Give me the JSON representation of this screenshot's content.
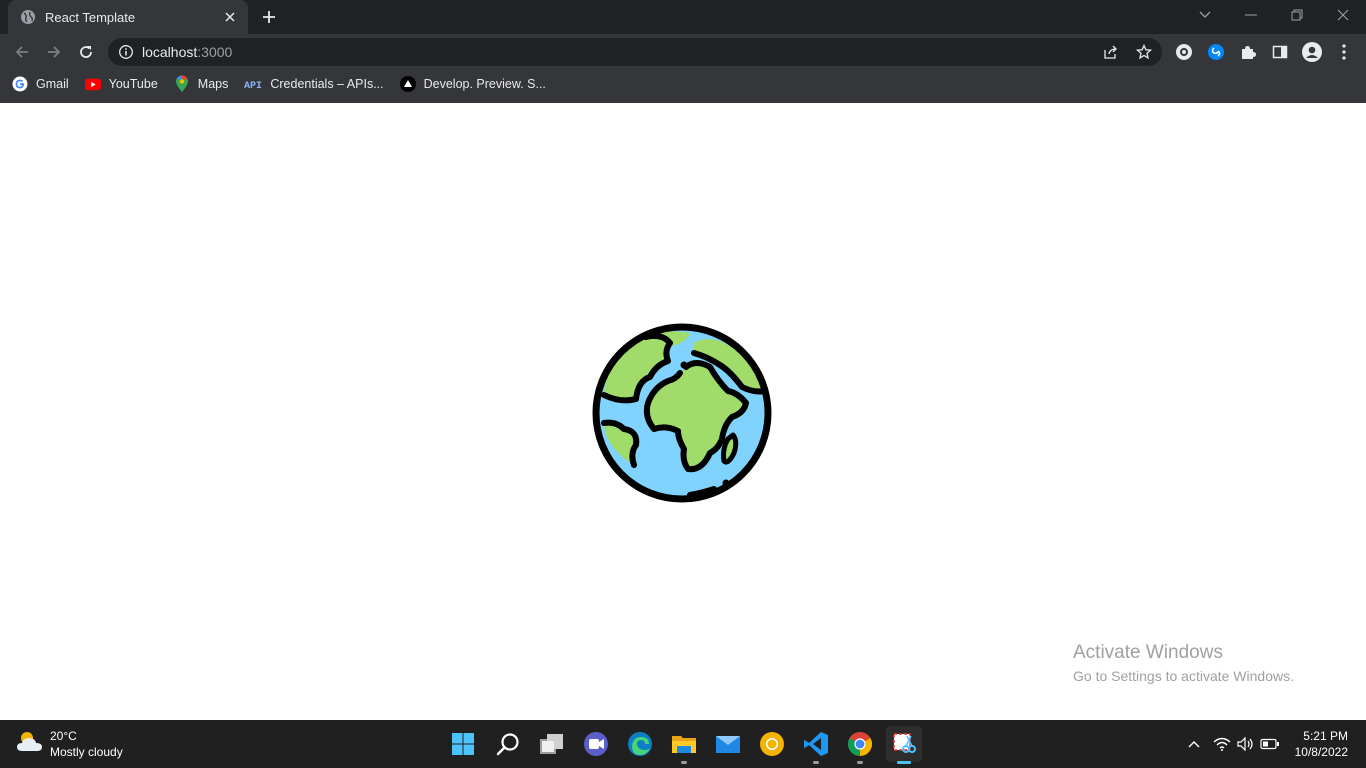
{
  "browser": {
    "tab": {
      "title": "React Template",
      "favicon": "globe-favicon"
    },
    "url": {
      "host": "localhost",
      "port": ":3000"
    },
    "bookmarks": [
      {
        "label": "Gmail",
        "icon": "google-icon"
      },
      {
        "label": "YouTube",
        "icon": "youtube-icon"
      },
      {
        "label": "Maps",
        "icon": "maps-pin-icon"
      },
      {
        "label": "Credentials – APIs...",
        "icon": "api-icon"
      },
      {
        "label": "Develop. Preview. S...",
        "icon": "vercel-triangle-icon"
      }
    ]
  },
  "page": {
    "image": "earth-globe-illustration"
  },
  "watermark": {
    "line1": "Activate Windows",
    "line2": "Go to Settings to activate Windows."
  },
  "taskbar": {
    "weather": {
      "temp": "20°C",
      "condition": "Mostly cloudy"
    },
    "apps": [
      "start-icon",
      "search-icon",
      "task-view-icon",
      "teams-chat-icon",
      "edge-icon",
      "file-explorer-icon",
      "mail-icon",
      "chrome-canary-icon",
      "vscode-icon",
      "chrome-icon",
      "snipping-tool-icon"
    ],
    "clock": {
      "time": "5:21 PM",
      "date": "10/8/2022"
    }
  },
  "colors": {
    "tabstrip": "#202124",
    "toolbar": "#35363a",
    "taskbar": "#202020",
    "globe_ocean": "#7fd3fc",
    "globe_land": "#a1dc6b",
    "outline": "#000000"
  }
}
